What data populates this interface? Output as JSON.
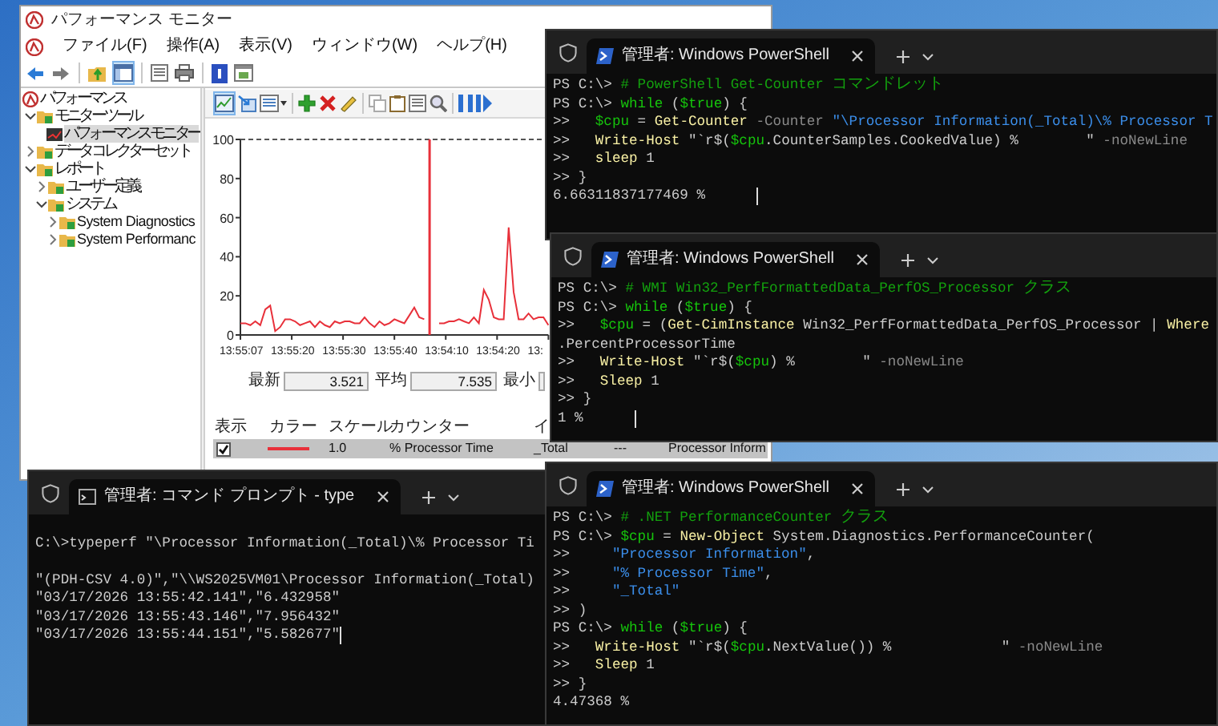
{
  "performance_monitor": {
    "title": "パフォーマンス モニター",
    "menu": [
      "ファイル(F)",
      "操作(A)",
      "表示(V)",
      "ウィンドウ(W)",
      "ヘルプ(H)"
    ],
    "toolbar_groups": [
      [
        {
          "kind": "back",
          "on": false
        },
        {
          "kind": "forward",
          "on": false
        }
      ],
      [
        {
          "kind": "up",
          "on": false
        },
        {
          "kind": "tree",
          "on": true
        }
      ],
      [
        {
          "kind": "properties",
          "on": false
        },
        {
          "kind": "export",
          "on": false
        }
      ],
      [
        {
          "kind": "help",
          "on": false
        },
        {
          "kind": "panel",
          "on": false
        }
      ]
    ],
    "tree": [
      {
        "label": "パフォーマンス",
        "selected": false,
        "children": [
          {
            "label": "モニター ツール",
            "selected": false,
            "expanded": true,
            "children": [
              {
                "label": "パフォーマンス モニター",
                "selected": true
              }
            ]
          },
          {
            "label": "データ コレクター セット",
            "selected": false,
            "expanded": false
          },
          {
            "label": "レポート",
            "selected": false,
            "expanded": true,
            "children": [
              {
                "label": "ユーザー定義",
                "selected": false,
                "expanded": false
              },
              {
                "label": "システム",
                "selected": false,
                "expanded": true,
                "children": [
                  {
                    "label": "System Diagnostics",
                    "selected": false,
                    "expanded": false
                  },
                  {
                    "label": "System Performanc",
                    "selected": false,
                    "expanded": false
                  }
                ]
              }
            ]
          }
        ]
      }
    ],
    "graph_toolbar_groups": [
      [
        {
          "kind": "graph",
          "on": true
        },
        {
          "kind": "freeze",
          "on": false
        },
        {
          "kind": "change-view",
          "on": false
        }
      ],
      [
        {
          "kind": "add",
          "on": false
        },
        {
          "kind": "delete",
          "on": false
        },
        {
          "kind": "highlight",
          "on": false
        }
      ],
      [
        {
          "kind": "copy",
          "on": false
        },
        {
          "kind": "paste",
          "on": false
        },
        {
          "kind": "properties",
          "on": false
        },
        {
          "kind": "zoom",
          "on": false
        }
      ],
      [
        {
          "kind": "pause",
          "on": false
        },
        {
          "kind": "step",
          "on": false
        }
      ]
    ],
    "y_axis_labels": [
      "100",
      "80",
      "60",
      "40",
      "20",
      "0"
    ],
    "time_labels": [
      "13:55:07",
      "13:55:20",
      "13:55:30",
      "13:55:40",
      "13:54:10",
      "13:54:20",
      "13:"
    ],
    "stats": [
      {
        "label": "最新",
        "value": "3.521"
      },
      {
        "label": "平均",
        "value": "7.535"
      },
      {
        "label": "最小"
      }
    ],
    "counter_table": {
      "columns": [
        "表示",
        "カラー",
        "スケール",
        "カウンター",
        "イ"
      ],
      "rows": [
        {
          "selected": true,
          "checked": true,
          "color": "#e8303a",
          "scale": "1.0",
          "counter": "% Processor Time",
          "column_5": "_Total",
          "column_6": "---",
          "column_7": "Processor Inform"
        }
      ]
    }
  },
  "terminals": [
    {
      "kind": "powershell",
      "tab": {
        "title": "管理者: Windows PowerShell",
        "selected": true
      },
      "lines": [
        {
          "segments": [
            {
              "kind": "prompt",
              "text": "PS C:\\> "
            },
            {
              "kind": "comment",
              "text": "# PowerShell Get-Counter コマンドレット"
            }
          ]
        },
        {
          "segments": [
            {
              "kind": "prompt",
              "text": "PS C:\\> "
            },
            {
              "kind": "keyword",
              "text": "while"
            },
            {
              "kind": "text",
              "text": " ("
            },
            {
              "kind": "variable",
              "text": "$true"
            },
            {
              "kind": "text",
              "text": ") {"
            }
          ]
        },
        {
          "segments": [
            {
              "kind": "prompt",
              "text": ">>   "
            },
            {
              "kind": "variable",
              "text": "$cpu"
            },
            {
              "kind": "text",
              "text": " = "
            },
            {
              "kind": "command",
              "text": "Get-Counter"
            },
            {
              "kind": "parameter",
              "text": " -Counter "
            },
            {
              "kind": "string",
              "text": "\"\\Processor Information(_Total)\\% Processor T"
            }
          ]
        },
        {
          "segments": [
            {
              "kind": "prompt",
              "text": ">>   "
            },
            {
              "kind": "command",
              "text": "Write-Host"
            },
            {
              "kind": "text",
              "text": " \"`r$("
            },
            {
              "kind": "variable",
              "text": "$cpu"
            },
            {
              "kind": "text",
              "text": ".CounterSamples.CookedValue) %        \""
            },
            {
              "kind": "parameter",
              "text": " -noNewLine"
            }
          ]
        },
        {
          "segments": [
            {
              "kind": "prompt",
              "text": ">>   "
            },
            {
              "kind": "command",
              "text": "sleep"
            },
            {
              "kind": "text",
              "text": " 1"
            }
          ]
        },
        {
          "segments": [
            {
              "kind": "prompt",
              "text": ">> "
            },
            {
              "kind": "text",
              "text": "}"
            }
          ]
        },
        {
          "segments": [
            {
              "kind": "text",
              "text": "6.66311837177469 %      "
            }
          ],
          "cursor": true
        }
      ]
    },
    {
      "kind": "powershell",
      "tab": {
        "title": "管理者: Windows PowerShell",
        "selected": true
      },
      "lines": [
        {
          "segments": [
            {
              "kind": "prompt",
              "text": "PS C:\\> "
            },
            {
              "kind": "comment",
              "text": "# WMI Win32_PerfFormattedData_PerfOS_Processor クラス"
            }
          ]
        },
        {
          "segments": [
            {
              "kind": "prompt",
              "text": "PS C:\\> "
            },
            {
              "kind": "keyword",
              "text": "while"
            },
            {
              "kind": "text",
              "text": " ("
            },
            {
              "kind": "variable",
              "text": "$true"
            },
            {
              "kind": "text",
              "text": ") {"
            }
          ]
        },
        {
          "segments": [
            {
              "kind": "prompt",
              "text": ">>   "
            },
            {
              "kind": "variable",
              "text": "$cpu"
            },
            {
              "kind": "text",
              "text": " = ("
            },
            {
              "kind": "command",
              "text": "Get-CimInstance"
            },
            {
              "kind": "text",
              "text": " Win32_PerfFormattedData_PerfOS_Processor | "
            },
            {
              "kind": "command",
              "text": "Where"
            }
          ]
        },
        {
          "segments": [
            {
              "kind": "text",
              "text": ".PercentProcessorTime"
            }
          ]
        },
        {
          "segments": [
            {
              "kind": "prompt",
              "text": ">>   "
            },
            {
              "kind": "command",
              "text": "Write-Host"
            },
            {
              "kind": "text",
              "text": " \"`r$("
            },
            {
              "kind": "variable",
              "text": "$cpu"
            },
            {
              "kind": "text",
              "text": ") %        \""
            },
            {
              "kind": "parameter",
              "text": " -noNewLine"
            }
          ]
        },
        {
          "segments": [
            {
              "kind": "prompt",
              "text": ">>   "
            },
            {
              "kind": "command",
              "text": "Sleep"
            },
            {
              "kind": "text",
              "text": " 1"
            }
          ]
        },
        {
          "segments": [
            {
              "kind": "prompt",
              "text": ">> "
            },
            {
              "kind": "text",
              "text": "}"
            }
          ]
        },
        {
          "segments": [
            {
              "kind": "text",
              "text": "1 %      "
            }
          ],
          "cursor": true
        }
      ]
    },
    {
      "kind": "cmd",
      "tab": {
        "title": "管理者: コマンド プロンプト - type",
        "selected": true
      },
      "lines": [
        {
          "segments": [
            {
              "kind": "text",
              "text": "C:\\>typeperf \"\\Processor Information(_Total)\\% Processor Ti"
            }
          ],
          "blank_before": true
        },
        {
          "segments": [
            {
              "kind": "text",
              "text": "\"(PDH-CSV 4.0)\",\"\\\\WS2025VM01\\Processor Information(_Total)"
            }
          ],
          "blank_before": true
        },
        {
          "segments": [
            {
              "kind": "text",
              "text": "\"03/17/2026 13:55:42.141\",\"6.432958\""
            }
          ]
        },
        {
          "segments": [
            {
              "kind": "text",
              "text": "\"03/17/2026 13:55:43.146\",\"7.956432\""
            }
          ]
        },
        {
          "segments": [
            {
              "kind": "text",
              "text": "\"03/17/2026 13:55:44.151\",\"5.582677\""
            }
          ],
          "cursor": true
        }
      ]
    },
    {
      "kind": "powershell",
      "tab": {
        "title": "管理者: Windows PowerShell",
        "selected": true
      },
      "lines": [
        {
          "segments": [
            {
              "kind": "prompt",
              "text": "PS C:\\> "
            },
            {
              "kind": "comment",
              "text": "# .NET PerformanceCounter クラス"
            }
          ]
        },
        {
          "segments": [
            {
              "kind": "prompt",
              "text": "PS C:\\> "
            },
            {
              "kind": "variable",
              "text": "$cpu"
            },
            {
              "kind": "text",
              "text": " = "
            },
            {
              "kind": "command",
              "text": "New-Object"
            },
            {
              "kind": "text",
              "text": " System.Diagnostics.PerformanceCounter("
            }
          ]
        },
        {
          "segments": [
            {
              "kind": "prompt",
              "text": ">>     "
            },
            {
              "kind": "string",
              "text": "\"Processor Information\""
            },
            {
              "kind": "text",
              "text": ","
            }
          ]
        },
        {
          "segments": [
            {
              "kind": "prompt",
              "text": ">>     "
            },
            {
              "kind": "string",
              "text": "\"% Processor Time\""
            },
            {
              "kind": "text",
              "text": ","
            }
          ]
        },
        {
          "segments": [
            {
              "kind": "prompt",
              "text": ">>     "
            },
            {
              "kind": "string",
              "text": "\"_Total\""
            }
          ]
        },
        {
          "segments": [
            {
              "kind": "prompt",
              "text": ">> "
            },
            {
              "kind": "text",
              "text": ")"
            }
          ]
        },
        {
          "segments": [
            {
              "kind": "prompt",
              "text": "PS C:\\> "
            },
            {
              "kind": "keyword",
              "text": "while"
            },
            {
              "kind": "text",
              "text": " ("
            },
            {
              "kind": "variable",
              "text": "$true"
            },
            {
              "kind": "text",
              "text": ") {"
            }
          ]
        },
        {
          "segments": [
            {
              "kind": "prompt",
              "text": ">>   "
            },
            {
              "kind": "command",
              "text": "Write-Host"
            },
            {
              "kind": "text",
              "text": " \"`r$("
            },
            {
              "kind": "variable",
              "text": "$cpu"
            },
            {
              "kind": "text",
              "text": ".NextValue()) %             \""
            },
            {
              "kind": "parameter",
              "text": " -noNewLine"
            }
          ]
        },
        {
          "segments": [
            {
              "kind": "prompt",
              "text": ">>   "
            },
            {
              "kind": "command",
              "text": "Sleep"
            },
            {
              "kind": "text",
              "text": " 1"
            }
          ]
        },
        {
          "segments": [
            {
              "kind": "prompt",
              "text": ">> "
            },
            {
              "kind": "text",
              "text": "}"
            }
          ]
        },
        {
          "segments": [
            {
              "kind": "text",
              "text": "4.47368 %"
            }
          ]
        }
      ]
    }
  ]
}
